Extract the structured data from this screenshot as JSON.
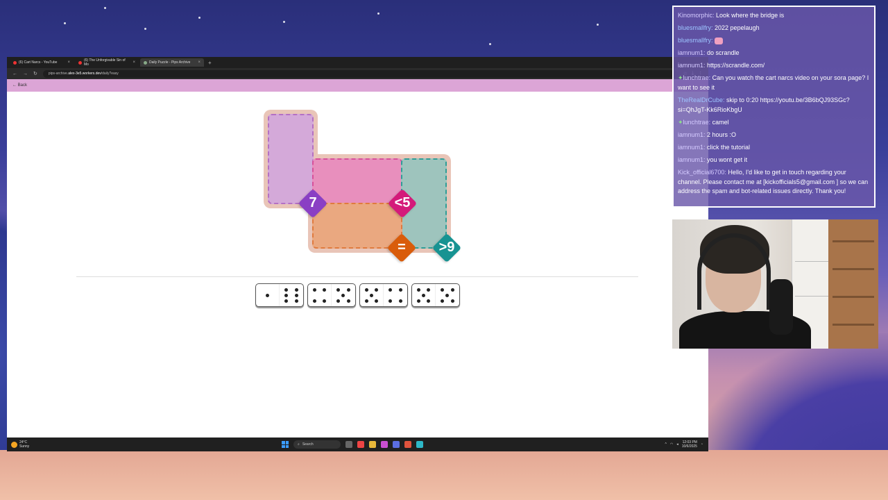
{
  "browser": {
    "tabs": [
      {
        "label": "(6) Cart Narcs - YouTube",
        "active": false
      },
      {
        "label": "(6) The Unforgivable Sin of Mo",
        "active": false
      },
      {
        "label": "Daily Puzzle - Pips Archive",
        "active": true
      }
    ],
    "url_prefix": "pips-archive.",
    "url_host": "alex-3e5.workers.dev",
    "url_path": "/daily?easy"
  },
  "page": {
    "back_label": "Back"
  },
  "puzzle": {
    "regions": [
      {
        "id": "purple",
        "color": "#c58fd0",
        "constraint": ""
      },
      {
        "id": "pink",
        "color": "#e58cc0",
        "constraint": ""
      },
      {
        "id": "teal",
        "color": "#9ec4bd",
        "constraint": ""
      },
      {
        "id": "orange",
        "color": "#eaa880",
        "constraint": ""
      }
    ],
    "constraints": [
      {
        "label": "7",
        "color": "#8a3fc4"
      },
      {
        "label": "<5",
        "color": "#d41a7a"
      },
      {
        "label": "=",
        "color": "#d95c0a"
      },
      {
        "label": ">9",
        "color": "#179392"
      }
    ],
    "dominoes": [
      [
        1,
        6
      ],
      [
        4,
        5
      ],
      [
        5,
        4
      ],
      [
        5,
        5
      ]
    ]
  },
  "taskbar": {
    "weather_temp": "24°C",
    "weather_desc": "Sunny",
    "search_label": "Search",
    "time": "12:03 PM",
    "date": "10/6/2025"
  },
  "chat": {
    "messages": [
      {
        "user": "Kinomorphic:",
        "text": "Look where the bridge is",
        "userColor": "purple"
      },
      {
        "user": "bluesmallfry:",
        "text": "2022 pepelaugh",
        "userColor": "blue"
      },
      {
        "user": "bluesmallfry:",
        "text": "",
        "userColor": "blue",
        "emote": true
      },
      {
        "user": "iamnum1:",
        "text": "do scrandle",
        "userColor": "purple"
      },
      {
        "user": "iamnum1:",
        "text": "https://scrandle.com/",
        "userColor": "purple"
      },
      {
        "user": "lunchtrae:",
        "text": "Can you watch the cart narcs video on your sora page? I want to see it",
        "userColor": "purple",
        "badge": true
      },
      {
        "user": "TheRealDrCube:",
        "text": "skip to 0:20 https://youtu.be/3B6bQJ93SGc?si=QhJgT-Kk6RioKbgU",
        "userColor": "blue"
      },
      {
        "user": "lunchtrae:",
        "text": "camel",
        "userColor": "purple",
        "badge": true
      },
      {
        "user": "iamnum1:",
        "text": "2 hours :O",
        "userColor": "purple"
      },
      {
        "user": "iamnum1:",
        "text": "click the tutorial",
        "userColor": "purple"
      },
      {
        "user": "iamnum1:",
        "text": "you wont get it",
        "userColor": "purple"
      },
      {
        "user": "Kick_official6700:",
        "text": "Hello, I'd like to get in touch regarding your channel. Please contact me at [kickofficials5@gmail.com ] so we can address the spam and bot-related issues directly. Thank you!",
        "userColor": "purple"
      }
    ]
  }
}
